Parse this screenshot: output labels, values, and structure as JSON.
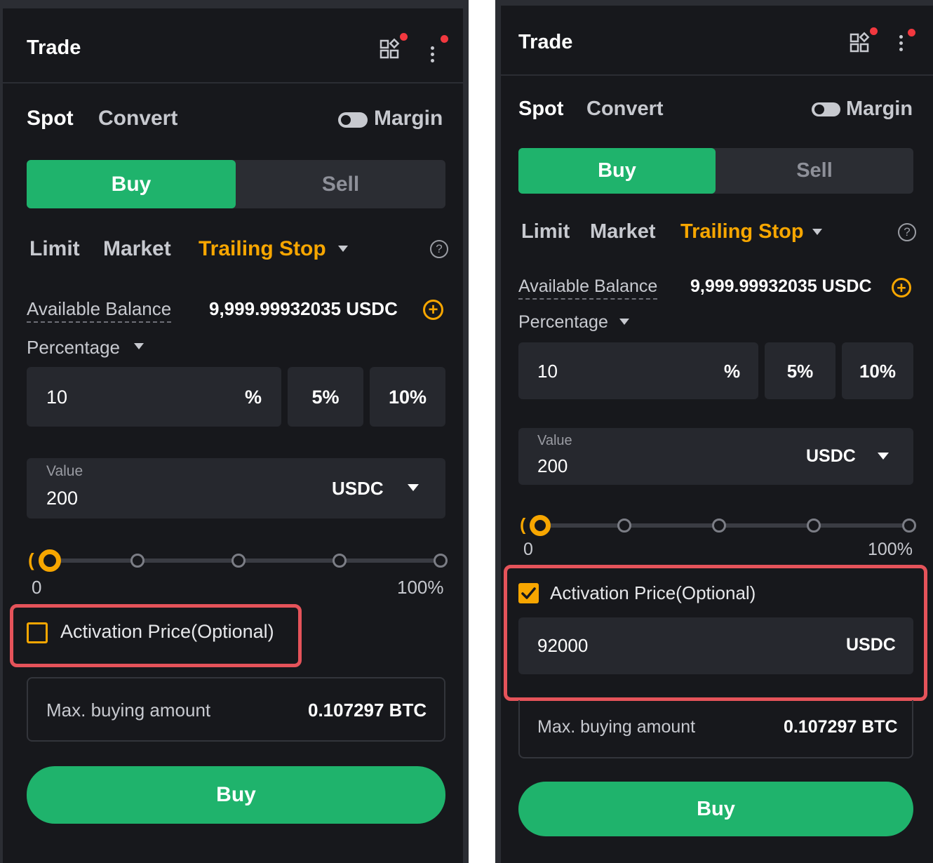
{
  "left": {
    "title": "Trade",
    "icons": {
      "apps": "apps-grid-icon",
      "menu": "more-vertical-icon"
    },
    "mode_tabs": {
      "spot": "Spot",
      "convert": "Convert"
    },
    "margin_label": "Margin",
    "side": {
      "buy": "Buy",
      "sell": "Sell"
    },
    "order_tabs": {
      "limit": "Limit",
      "market": "Market",
      "trailing": "Trailing Stop"
    },
    "help_glyph": "?",
    "available_label": "Available Balance",
    "available_value": "9,999.99932035 USDC",
    "plus_glyph": "+",
    "percentage_label": "Percentage",
    "pct_input": "10",
    "pct_unit": "%",
    "pct_options": [
      "5%",
      "10%"
    ],
    "value_label": "Value",
    "value_amount": "200",
    "value_currency": "USDC",
    "slider": {
      "min_label": "0",
      "max_label": "100%",
      "level": 0
    },
    "activation": {
      "label": "Activation Price(Optional)",
      "checked": false
    },
    "max_label": "Max. buying amount",
    "max_value": "0.107297 BTC",
    "buy_button": "Buy"
  },
  "right": {
    "title": "Trade",
    "icons": {
      "apps": "apps-grid-icon",
      "menu": "more-vertical-icon"
    },
    "mode_tabs": {
      "spot": "Spot",
      "convert": "Convert"
    },
    "margin_label": "Margin",
    "side": {
      "buy": "Buy",
      "sell": "Sell"
    },
    "order_tabs": {
      "limit": "Limit",
      "market": "Market",
      "trailing": "Trailing Stop"
    },
    "help_glyph": "?",
    "available_label": "Available Balance",
    "available_value": "9,999.99932035 USDC",
    "plus_glyph": "+",
    "percentage_label": "Percentage",
    "pct_input": "10",
    "pct_unit": "%",
    "pct_options": [
      "5%",
      "10%"
    ],
    "value_label": "Value",
    "value_amount": "200",
    "value_currency": "USDC",
    "slider": {
      "min_label": "0",
      "max_label": "100%",
      "level": 0
    },
    "activation": {
      "label": "Activation Price(Optional)",
      "checked": true,
      "price": "92000",
      "currency": "USDC"
    },
    "max_label": "Max. buying amount",
    "max_value": "0.107297 BTC",
    "buy_button": "Buy"
  },
  "colors": {
    "accent": "#f7a600",
    "buy": "#1fb36c",
    "highlight": "#e5535a",
    "bg": "#17181c",
    "field": "#26282e"
  }
}
